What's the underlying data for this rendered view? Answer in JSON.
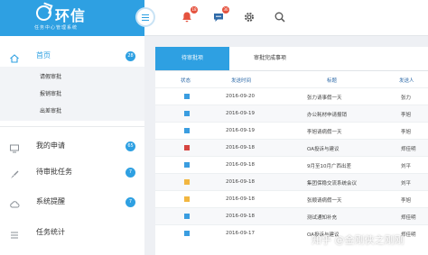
{
  "brand": {
    "logo_text": "环信",
    "subtitle": "任务中心管理系统"
  },
  "topbar": {
    "icons": [
      {
        "name": "bell-icon",
        "badge": "18"
      },
      {
        "name": "chat-icon",
        "badge": "36"
      },
      {
        "name": "gear-icon",
        "badge": ""
      },
      {
        "name": "search-icon",
        "badge": ""
      }
    ]
  },
  "sidebar": {
    "home": {
      "label": "首页",
      "count": "28"
    },
    "sub_items": [
      "请假审批",
      "报销审批",
      "出差审批"
    ],
    "items": [
      {
        "label": "我的申请",
        "count": "65"
      },
      {
        "label": "待审批任务",
        "count": "7"
      },
      {
        "label": "系统提醒",
        "count": "7"
      },
      {
        "label": "任务统计",
        "count": ""
      }
    ]
  },
  "tabs": {
    "active": "待审批项",
    "inactive": "审批完成事项"
  },
  "table": {
    "headers": {
      "status": "状态",
      "date": "发送时间",
      "title": "标题",
      "sender": "发送人"
    },
    "rows": [
      {
        "color": "#3a9de0",
        "date": "2016-09-20",
        "title": "张力请事假一天",
        "sender": "张力"
      },
      {
        "color": "#3a9de0",
        "date": "2016-09-19",
        "title": "办公耗材申请报销",
        "sender": "李旭"
      },
      {
        "color": "#3a9de0",
        "date": "2016-09-19",
        "title": "李旭请病假一天",
        "sender": "李旭"
      },
      {
        "color": "#d64541",
        "date": "2016-09-18",
        "title": "OA投诉与建议",
        "sender": "郑佳明"
      },
      {
        "color": "#3a9de0",
        "date": "2016-09-18",
        "title": "9月至10月广西出差",
        "sender": "刘平"
      },
      {
        "color": "#f2b640",
        "date": "2016-09-18",
        "title": "集团保稳交流系统会议",
        "sender": "刘平"
      },
      {
        "color": "#f2b640",
        "date": "2016-09-18",
        "title": "张顺请病假一天",
        "sender": "李旭"
      },
      {
        "color": "#3a9de0",
        "date": "2016-09-18",
        "title": "测试通知补充",
        "sender": "郑佳明"
      },
      {
        "color": "#3a9de0",
        "date": "2016-09-17",
        "title": "OA投诉与建议",
        "sender": "郑佳明"
      }
    ]
  },
  "watermark": "知乎 @金刚侠之刚刚"
}
